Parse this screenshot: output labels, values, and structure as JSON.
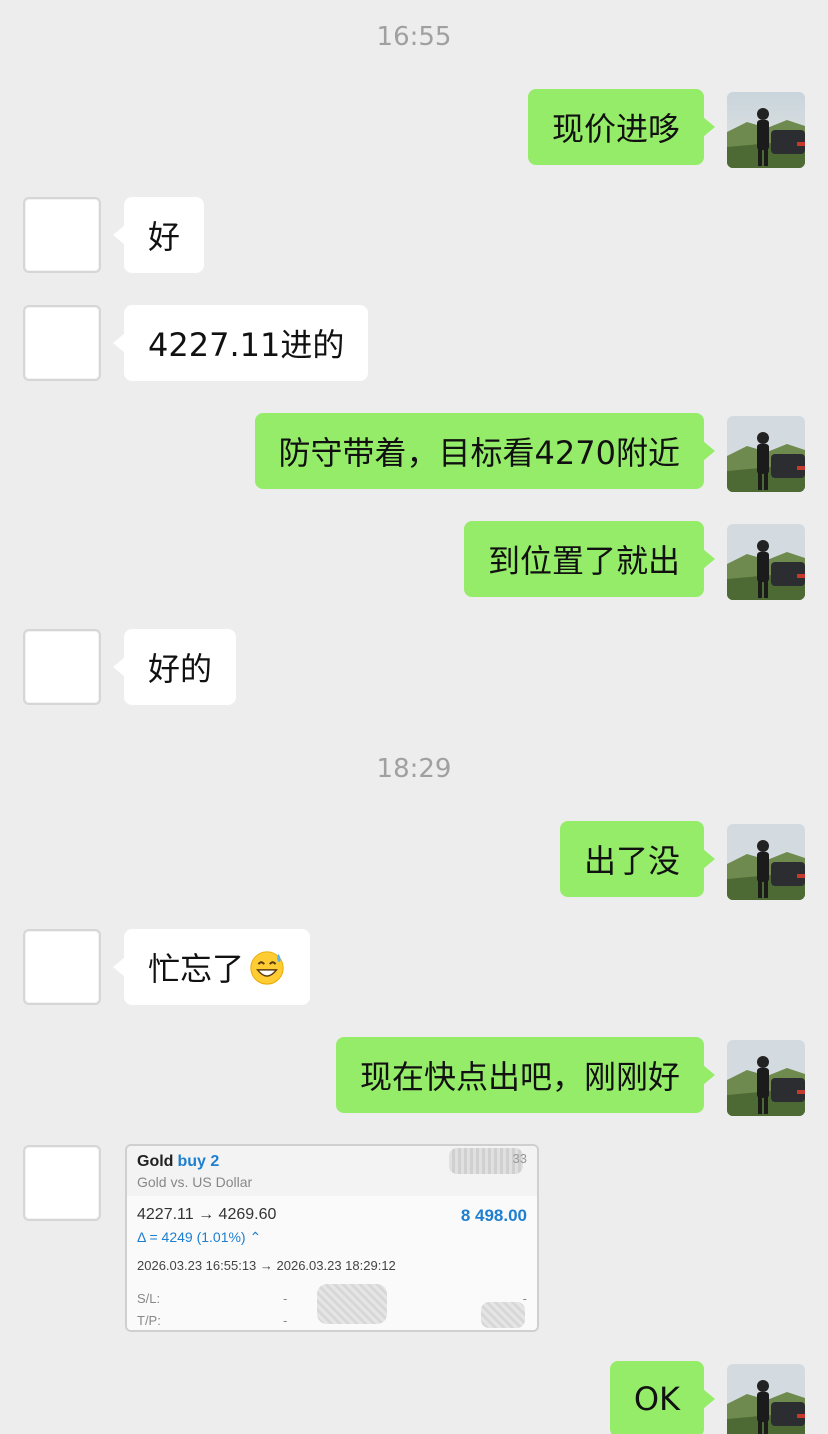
{
  "timestamps": [
    "16:55",
    "18:29"
  ],
  "messages": [
    {
      "from": "me",
      "text": "现价进哆"
    },
    {
      "from": "them",
      "text": "好"
    },
    {
      "from": "them",
      "text": "4227.11进的"
    },
    {
      "from": "me",
      "text": "防守带着，目标看4270附近"
    },
    {
      "from": "me",
      "text": "到位置了就出"
    },
    {
      "from": "them",
      "text": "好的"
    },
    {
      "from": "me",
      "text": "出了没"
    },
    {
      "from": "them",
      "text": "忙忘了",
      "emoji": "grinning-sweat-emoji"
    },
    {
      "from": "me",
      "text": "现在快点出吧，刚刚好"
    },
    {
      "from": "me",
      "text": "OK"
    }
  ],
  "trade_card": {
    "symbol": "Gold",
    "action": "buy 2",
    "description": "Gold vs. US Dollar",
    "code_partial": "33",
    "price_line": "4227.11 → 4269.60",
    "profit": "8 498.00",
    "delta": "Δ = 4249 (1.01%) ⌃",
    "dates": "2026.03.23 16:55:13 → 2026.03.23 18:29:12",
    "sl_label": "S/L:",
    "tp_label": "T/P:",
    "dash": "-"
  },
  "colors": {
    "background": "#ededed",
    "my_bubble": "#95ec69",
    "their_bubble": "#ffffff",
    "accent_blue": "#1e7fd0"
  }
}
